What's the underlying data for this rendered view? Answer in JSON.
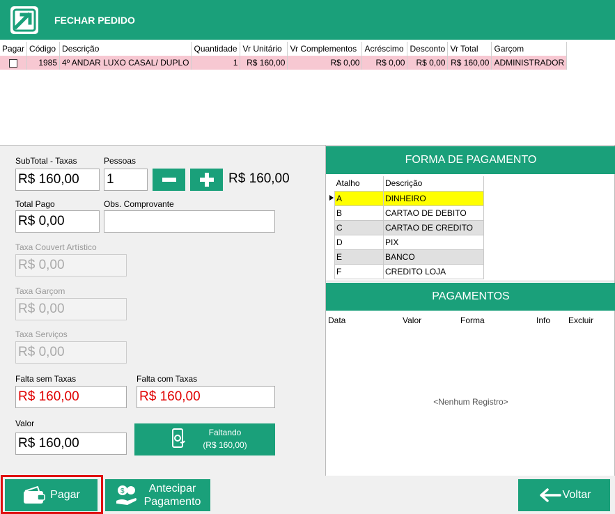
{
  "window": {
    "title": "FECHAR PEDIDO"
  },
  "items_table": {
    "columns": [
      "Pagar",
      "Código",
      "Descrição",
      "Quantidade",
      "Vr Unitário",
      "Vr Complementos",
      "Acréscimo",
      "Desconto",
      "Vr Total",
      "Garçom"
    ],
    "rows": [
      {
        "codigo": "1985",
        "descricao": "4º ANDAR LUXO CASAL/ DUPLO",
        "quantidade": "1",
        "vr_unitario": "R$ 160,00",
        "vr_complementos": "R$ 0,00",
        "acrescimo": "R$ 0,00",
        "desconto": "R$ 0,00",
        "vr_total": "R$ 160,00",
        "garcom": "ADMINISTRADOR"
      }
    ]
  },
  "form": {
    "subtotal_label": "SubTotal - Taxas",
    "subtotal_value": "R$ 160,00",
    "pessoas_label": "Pessoas",
    "pessoas_value": "1",
    "per_person": "R$ 160,00",
    "total_pago_label": "Total Pago",
    "total_pago_value": "R$ 0,00",
    "obs_label": "Obs. Comprovante",
    "obs_value": "",
    "couvert_label": "Taxa Couvert Artístico",
    "couvert_value": "R$ 0,00",
    "garcom_label": "Taxa Garçom",
    "garcom_value": "R$ 0,00",
    "servicos_label": "Taxa Serviços",
    "servicos_value": "R$ 0,00",
    "falta_sem_label": "Falta sem Taxas",
    "falta_sem_value": "R$ 160,00",
    "falta_com_label": "Falta com Taxas",
    "falta_com_value": "R$ 160,00",
    "valor_label": "Valor",
    "valor_value": "R$ 160,00",
    "faltando_line1": "Faltando",
    "faltando_line2": "(R$ 160,00)"
  },
  "forma_pagamento": {
    "title": "FORMA DE PAGAMENTO",
    "columns": [
      "Atalho",
      "Descrição"
    ],
    "rows": [
      {
        "atalho": "A",
        "descricao": "DINHEIRO"
      },
      {
        "atalho": "B",
        "descricao": "CARTAO DE DEBITO"
      },
      {
        "atalho": "C",
        "descricao": "CARTAO DE CREDITO"
      },
      {
        "atalho": "D",
        "descricao": "PIX"
      },
      {
        "atalho": "E",
        "descricao": "BANCO"
      },
      {
        "atalho": "F",
        "descricao": "CREDITO LOJA"
      }
    ]
  },
  "pagamentos": {
    "title": "PAGAMENTOS",
    "columns": [
      "Data",
      "Valor",
      "Forma",
      "Info",
      "Excluir"
    ],
    "empty_text": "<Nenhum Registro>"
  },
  "buttons": {
    "pagar": "Pagar",
    "antecipar_line1": "Antecipar",
    "antecipar_line2": "Pagamento",
    "voltar": "Voltar"
  },
  "colors": {
    "accent": "#1aa07a",
    "row_pink": "#f7c8d2",
    "selected": "#ffff00",
    "red_text": "#e00000"
  }
}
